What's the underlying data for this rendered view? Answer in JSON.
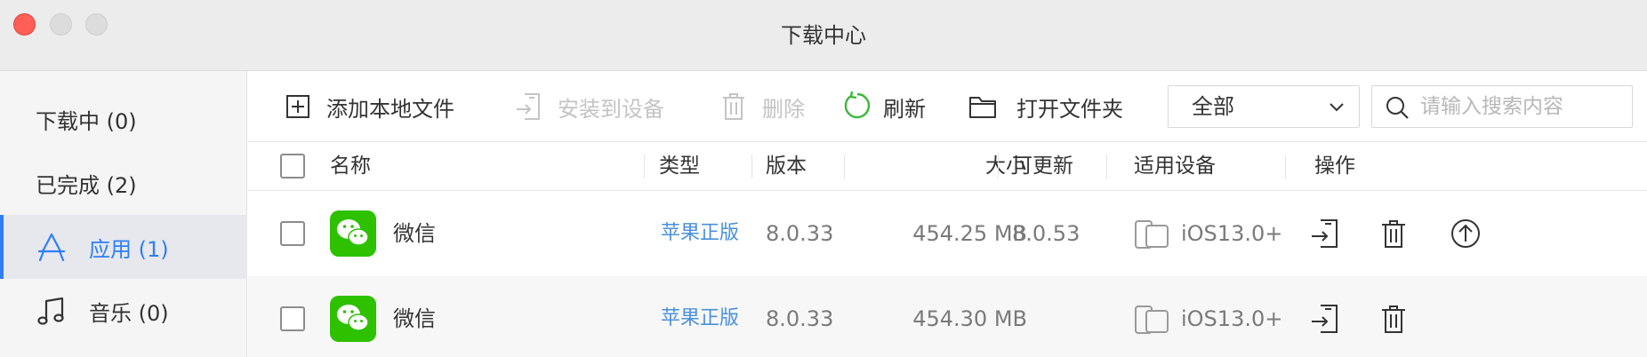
{
  "window": {
    "title": "下载中心"
  },
  "sidebar": {
    "items": [
      {
        "label": "下载中 (0)"
      },
      {
        "label": "已完成 (2)"
      },
      {
        "label": "应用 (1)",
        "icon": "app-store-icon",
        "active": true
      },
      {
        "label": "音乐 (0)",
        "icon": "music-note-icon"
      }
    ]
  },
  "toolbar": {
    "add_local": "添加本地文件",
    "install": "安装到设备",
    "delete": "删除",
    "refresh": "刷新",
    "open_folder": "打开文件夹"
  },
  "filter": {
    "selected": "全部"
  },
  "search": {
    "placeholder": "请输入搜索内容",
    "value": ""
  },
  "table": {
    "headers": {
      "name": "名称",
      "type": "类型",
      "version": "版本",
      "size": "大小",
      "updatable": "可更新",
      "device": "适用设备",
      "actions": "操作"
    },
    "rows": [
      {
        "name": "微信",
        "type": "苹果正版",
        "version": "8.0.33",
        "size": "454.25 MB",
        "updatable": "8.0.53",
        "device": "iOS13.0+"
      },
      {
        "name": "微信",
        "type": "苹果正版",
        "version": "8.0.33",
        "size": "454.30 MB",
        "updatable": "",
        "device": "iOS13.0+"
      }
    ]
  },
  "colors": {
    "accent": "#2f7ef6",
    "link": "#4a90d9",
    "wechat_green": "#2dc100",
    "refresh_green": "#3cb83c"
  }
}
